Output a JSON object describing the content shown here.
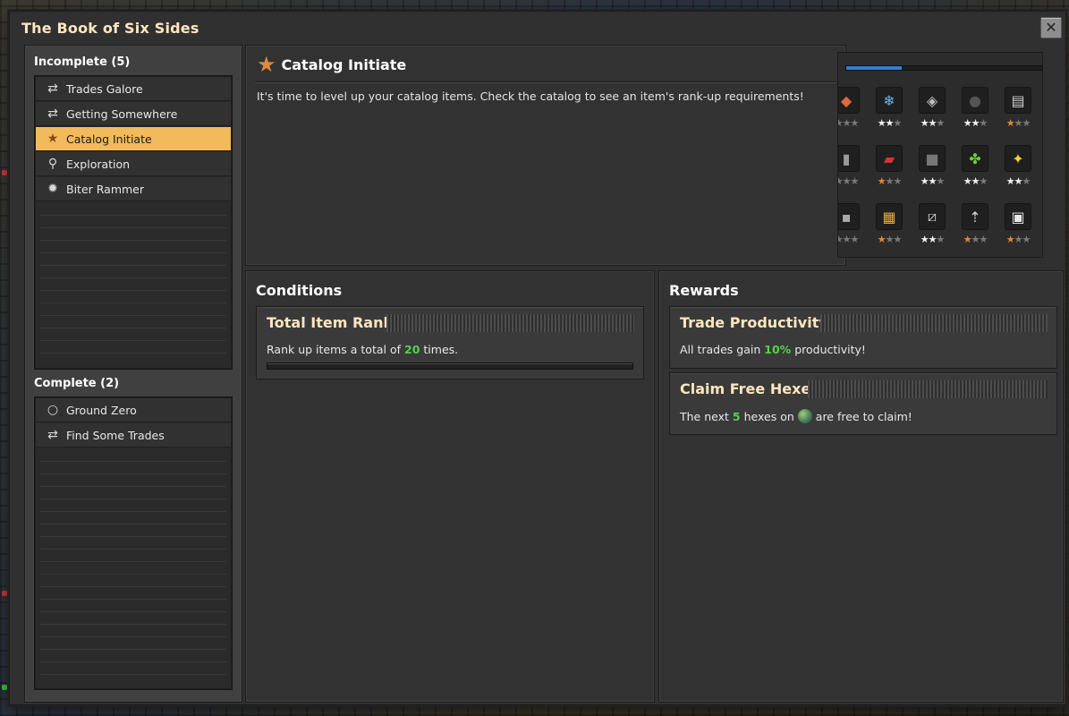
{
  "window": {
    "title": "The Book of Six Sides",
    "close_glyph": "✕"
  },
  "incomplete": {
    "header": "Incomplete (5)",
    "items": [
      {
        "label": "Trades Galore",
        "icon": "trade-icon",
        "selected": false
      },
      {
        "label": "Getting Somewhere",
        "icon": "trade-icon",
        "selected": false
      },
      {
        "label": "Catalog Initiate",
        "icon": "star-icon",
        "selected": true
      },
      {
        "label": "Exploration",
        "icon": "map-pin-icon",
        "selected": false
      },
      {
        "label": "Biter Rammer",
        "icon": "biter-icon",
        "selected": false
      }
    ]
  },
  "complete": {
    "header": "Complete (2)",
    "items": [
      {
        "label": "Ground Zero",
        "icon": "ring-icon"
      },
      {
        "label": "Find Some Trades",
        "icon": "trade-icon"
      }
    ]
  },
  "quest": {
    "title": "Catalog Initiate",
    "description": "It's time to level up your catalog items. Check the catalog to see an item's rank-up requirements!"
  },
  "catalog": {
    "progress": 0.27,
    "unknown_glyph": "?",
    "items": [
      {
        "icon": "copper-ore-icon",
        "stars": [
          0,
          0,
          0
        ],
        "tier": "white"
      },
      {
        "icon": "ice-crystal-icon",
        "stars": [
          1,
          1,
          0
        ],
        "tier": "white"
      },
      {
        "icon": "iron-plate-icon",
        "stars": [
          1,
          1,
          0
        ],
        "tier": "white"
      },
      {
        "icon": "coal-icon",
        "stars": [
          1,
          1,
          0
        ],
        "tier": "white"
      },
      {
        "icon": "stone-brick-icon",
        "stars": [
          1,
          0,
          0
        ],
        "tier": "gold"
      },
      {
        "icon": "gear-item-icon",
        "stars": [
          1,
          0,
          0
        ],
        "tier": "gold"
      },
      {
        "icon": "pipe-icon",
        "stars": [
          0,
          0,
          0
        ],
        "tier": "white"
      },
      {
        "icon": "red-circuit-icon",
        "stars": [
          1,
          0,
          0
        ],
        "tier": "gold"
      },
      {
        "icon": "steel-plate-icon",
        "stars": [
          1,
          1,
          0
        ],
        "tier": "white"
      },
      {
        "icon": "green-ore-icon",
        "stars": [
          1,
          1,
          0
        ],
        "tier": "white"
      },
      {
        "icon": "gold-ore-icon",
        "stars": [
          1,
          1,
          0
        ],
        "tier": "white"
      },
      {
        "icon": "red-flask-icon",
        "stars": [
          1,
          0,
          0
        ],
        "tier": "gold"
      },
      {
        "icon": "stone-icon",
        "stars": [
          0,
          0,
          0
        ],
        "tier": "white"
      },
      {
        "icon": "hazard-crate-icon",
        "stars": [
          1,
          0,
          0
        ],
        "tier": "gold"
      },
      {
        "icon": "steel-beam-icon",
        "stars": [
          1,
          1,
          0
        ],
        "tier": "white"
      },
      {
        "icon": "rocket-icon",
        "stars": [
          1,
          0,
          0
        ],
        "tier": "gold"
      },
      {
        "icon": "furnace-icon",
        "stars": [
          1,
          0,
          0
        ],
        "tier": "gold"
      },
      {
        "icon": "unknown-icon",
        "stars": [],
        "tier": "white"
      }
    ]
  },
  "conditions": {
    "header": "Conditions",
    "cards": [
      {
        "title": "Total Item Rank",
        "text_before": "Rank up items a total of",
        "value": "20",
        "text_after": "times.",
        "progress": 0
      }
    ]
  },
  "rewards": {
    "header": "Rewards",
    "cards": [
      {
        "title": "Trade Productivity",
        "text_before": "All trades gain",
        "value": "10%",
        "text_after": "productivity!"
      },
      {
        "title": "Claim Free Hexes",
        "text_before": "The next",
        "value": "5",
        "text_mid": "hexes on",
        "text_after": "are free to claim!"
      }
    ]
  },
  "colors": {
    "accent_selected": "#f2ba5b",
    "title_text": "#ffe6c0",
    "highlight_green": "#52d34a",
    "catalog_progress": "#2f7fd6",
    "star_gold": "#e8872c"
  }
}
